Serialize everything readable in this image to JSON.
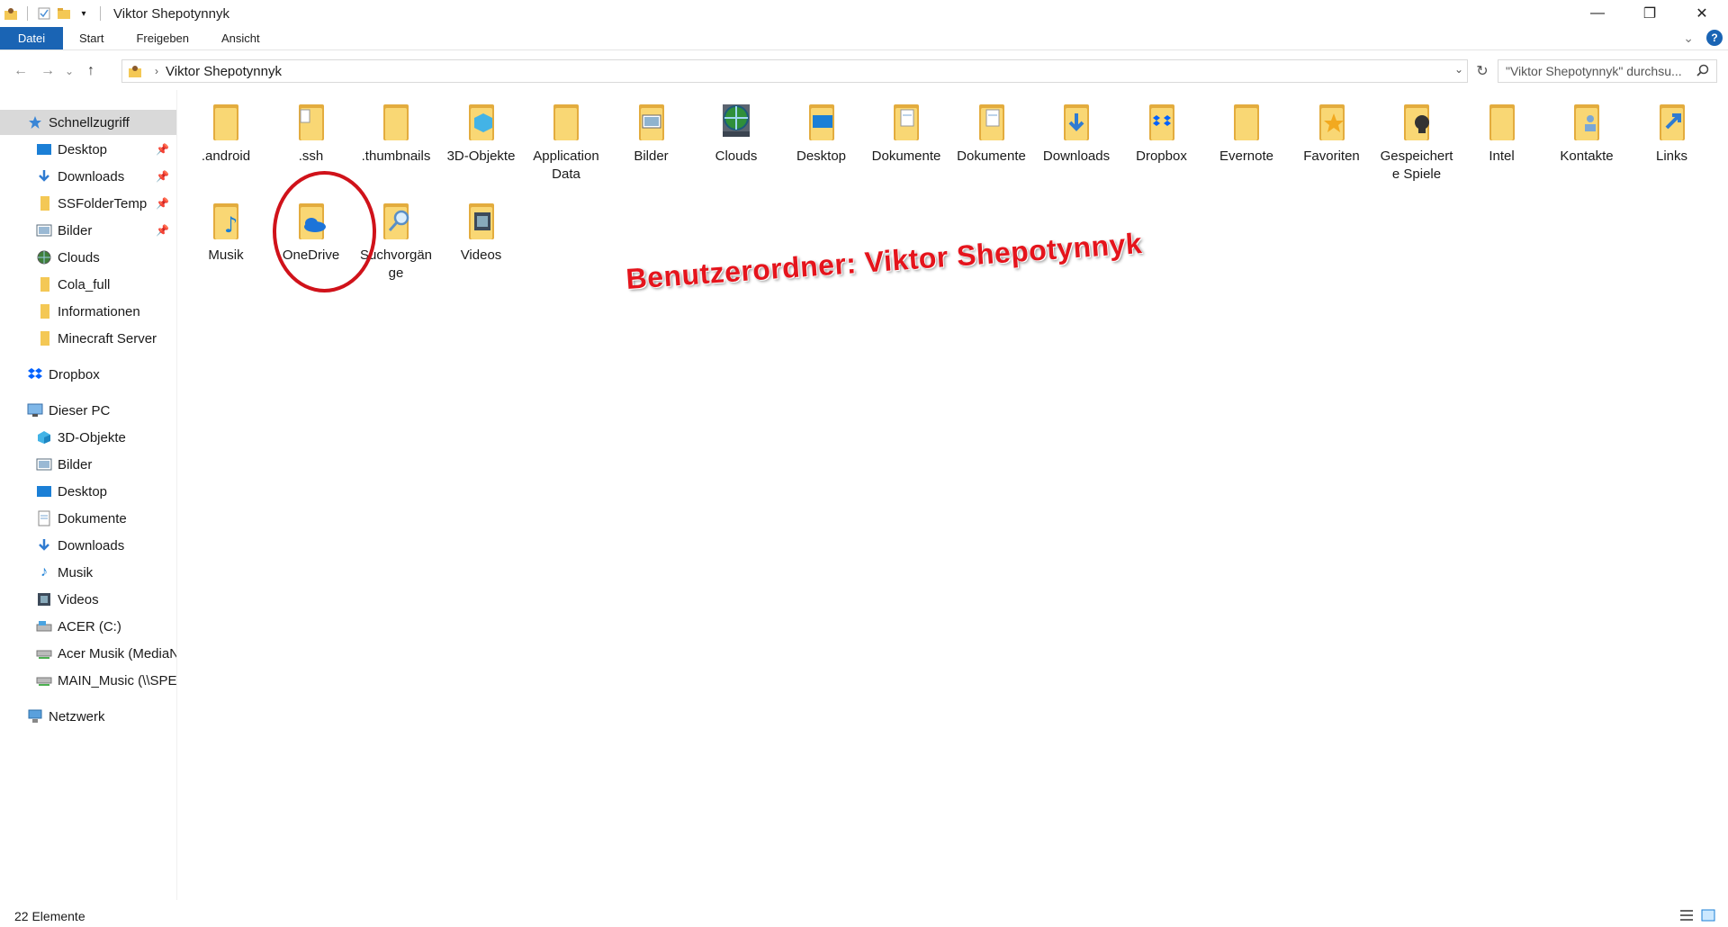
{
  "window": {
    "title": "Viktor Shepotynnyk",
    "controls": {
      "minimize": "—",
      "restore": "❐",
      "close": "✕"
    }
  },
  "ribbon": {
    "tabs": [
      {
        "label": "Datei",
        "active": true
      },
      {
        "label": "Start"
      },
      {
        "label": "Freigeben"
      },
      {
        "label": "Ansicht"
      }
    ],
    "help": "?",
    "accent": "#1a64b4"
  },
  "nav": {
    "back": "←",
    "forward": "→",
    "recent": "⌄",
    "up": "↑",
    "breadcrumb": "Viktor Shepotynnyk",
    "search_placeholder": "\"Viktor Shepotynnyk\" durchsu..."
  },
  "sidebar": {
    "quick_access": {
      "label": "Schnellzugriff",
      "icon": "star-icon"
    },
    "quick_items": [
      {
        "label": "Desktop",
        "icon": "desktop-icon",
        "pinned": true
      },
      {
        "label": "Downloads",
        "icon": "download-icon",
        "pinned": true
      },
      {
        "label": "SSFolderTemp",
        "icon": "folder-icon",
        "pinned": true
      },
      {
        "label": "Bilder",
        "icon": "pictures-icon",
        "pinned": true
      },
      {
        "label": "Clouds",
        "icon": "globe-icon",
        "pinned": false
      },
      {
        "label": "Cola_full",
        "icon": "folder-icon",
        "pinned": false
      },
      {
        "label": "Informationen",
        "icon": "folder-icon",
        "pinned": false
      },
      {
        "label": "Minecraft Server",
        "icon": "folder-icon",
        "pinned": false
      }
    ],
    "dropbox": {
      "label": "Dropbox",
      "icon": "dropbox-icon"
    },
    "this_pc": {
      "label": "Dieser PC",
      "icon": "pc-icon"
    },
    "pc_items": [
      {
        "label": "3D-Objekte",
        "icon": "cube-icon"
      },
      {
        "label": "Bilder",
        "icon": "pictures-icon"
      },
      {
        "label": "Desktop",
        "icon": "desktop-icon"
      },
      {
        "label": "Dokumente",
        "icon": "document-icon"
      },
      {
        "label": "Downloads",
        "icon": "download-icon"
      },
      {
        "label": "Musik",
        "icon": "music-icon"
      },
      {
        "label": "Videos",
        "icon": "video-icon"
      },
      {
        "label": "ACER (C:)",
        "icon": "drive-icon"
      },
      {
        "label": "Acer Musik (MediaN",
        "icon": "network-drive-icon"
      },
      {
        "label": "MAIN_Music (\\\\SPEI",
        "icon": "network-drive-icon"
      }
    ],
    "network": {
      "label": "Netzwerk",
      "icon": "network-icon"
    }
  },
  "content": {
    "row1": [
      {
        "label": ".android",
        "icon": "folder-icon"
      },
      {
        "label": ".ssh",
        "icon": "file-folder-icon"
      },
      {
        "label": ".thumbnails",
        "icon": "folder-icon"
      },
      {
        "label": "3D-Objekte",
        "icon": "cube-folder-icon"
      },
      {
        "label": "Application Data",
        "icon": "folder-icon"
      },
      {
        "label": "Bilder",
        "icon": "pictures-folder-icon"
      },
      {
        "label": "Clouds",
        "icon": "globe-icon"
      },
      {
        "label": "Desktop",
        "icon": "desktop-folder-icon"
      },
      {
        "label": "Dokumente",
        "icon": "document-folder-icon"
      },
      {
        "label": "Dokumente",
        "icon": "document-folder-icon"
      },
      {
        "label": "Downloads",
        "icon": "download-folder-icon"
      },
      {
        "label": "Dropbox",
        "icon": "dropbox-folder-icon"
      },
      {
        "label": "Evernote",
        "icon": "folder-icon"
      },
      {
        "label": "Favoriten",
        "icon": "star-folder-icon"
      },
      {
        "label": "Gespeicherte Spiele",
        "icon": "games-folder-icon"
      },
      {
        "label": "Intel",
        "icon": "folder-icon"
      },
      {
        "label": "Kontakte",
        "icon": "contacts-folder-icon"
      },
      {
        "label": "Links",
        "icon": "links-folder-icon"
      }
    ],
    "row2": [
      {
        "label": "Musik",
        "icon": "music-folder-icon"
      },
      {
        "label": "OneDrive",
        "icon": "onedrive-folder-icon"
      },
      {
        "label": "Suchvorgänge",
        "icon": "search-folder-icon"
      },
      {
        "label": "Videos",
        "icon": "video-folder-icon"
      }
    ]
  },
  "annotation": {
    "text": "Benutzerordner: Viktor Shepotynnyk",
    "color": "#e5141c"
  },
  "status": {
    "count": "22 Elemente"
  }
}
